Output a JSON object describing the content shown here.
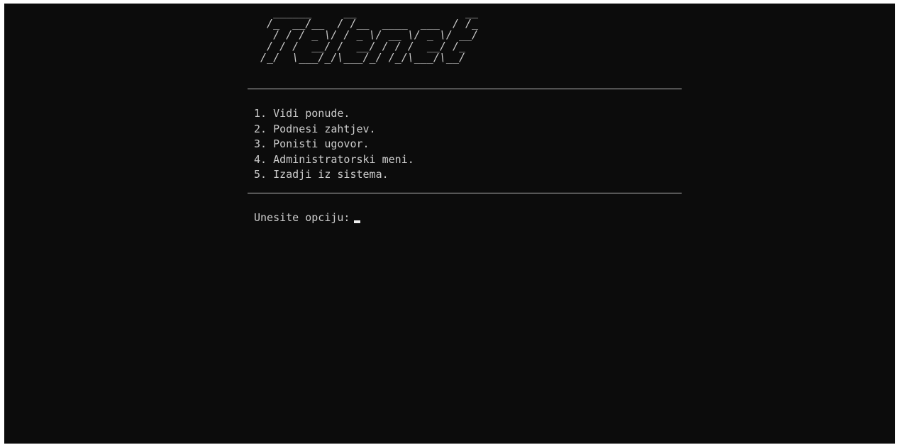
{
  "banner": {
    "ascii_art": "   ______     __                 __\n  /_  __/__  / /__  ____  ___  / /_\n   / / / _ \\/ / _ \\/ __ \\/ _ \\/ __/\n  / / /  __/ /  __/ / / /  __/ /_\n /_/  \\___/_/\\___/_/ /_/\\___/\\__/"
  },
  "menu": {
    "items": [
      "1. Vidi ponude.",
      "2. Podnesi zahtjev.",
      "3. Ponisti ugovor.",
      "4. Administratorski meni.",
      "5. Izadji iz sistema."
    ]
  },
  "prompt": {
    "label": "Unesite opciju:"
  },
  "colors": {
    "background": "#0c0c0c",
    "foreground": "#cccccc"
  }
}
